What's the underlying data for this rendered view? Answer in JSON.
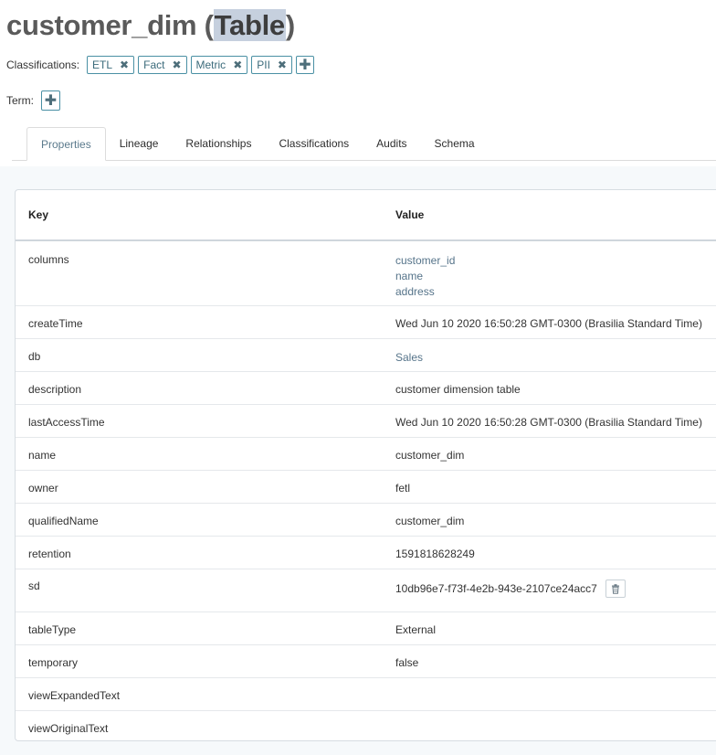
{
  "header": {
    "entity_name": "customer_dim",
    "open_paren": "(",
    "type_label": "Table",
    "close_paren": ")"
  },
  "classifications": {
    "label": "Classifications:",
    "items": [
      "ETL",
      "Fact",
      "Metric",
      "PII"
    ],
    "remove_glyph": "✖",
    "add_glyph": "✚"
  },
  "term": {
    "label": "Term:",
    "add_glyph": "✚"
  },
  "tabs": [
    "Properties",
    "Lineage",
    "Relationships",
    "Classifications",
    "Audits",
    "Schema"
  ],
  "table": {
    "headers": {
      "key": "Key",
      "value": "Value"
    },
    "rows": [
      {
        "key": "columns",
        "links": [
          "customer_id",
          "name",
          "address"
        ]
      },
      {
        "key": "createTime",
        "value": "Wed Jun 10 2020 16:50:28 GMT-0300 (Brasilia Standard Time)"
      },
      {
        "key": "db",
        "link": "Sales"
      },
      {
        "key": "description",
        "value": "customer dimension table"
      },
      {
        "key": "lastAccessTime",
        "value": "Wed Jun 10 2020 16:50:28 GMT-0300 (Brasilia Standard Time)"
      },
      {
        "key": "name",
        "value": "customer_dim"
      },
      {
        "key": "owner",
        "value": "fetl"
      },
      {
        "key": "qualifiedName",
        "value": "customer_dim"
      },
      {
        "key": "retention",
        "value": "1591818628249"
      },
      {
        "key": "sd",
        "value": "10db96e7-f73f-4e2b-943e-2107ce24acc7"
      },
      {
        "key": "tableType",
        "value": "External"
      },
      {
        "key": "temporary",
        "value": "false"
      },
      {
        "key": "viewExpandedText",
        "value": ""
      },
      {
        "key": "viewOriginalText",
        "value": ""
      }
    ]
  },
  "colors": {
    "accent": "#4a90a4",
    "link": "#56748a",
    "title": "#5a5a5a",
    "title_highlight": "#c6d0de",
    "content_bg": "#f6f9fb"
  }
}
